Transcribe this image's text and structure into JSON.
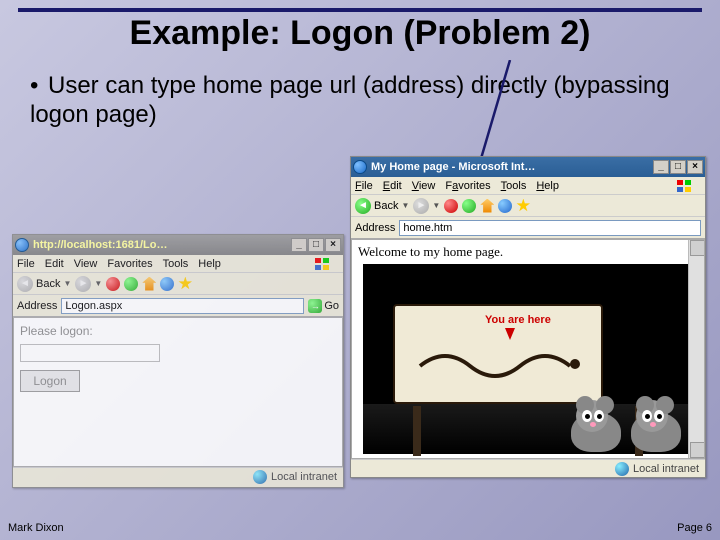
{
  "slide": {
    "title": "Example: Logon (Problem 2)",
    "bullet": "User can type home page url (address) directly (bypassing logon page)",
    "footer_left": "Mark Dixon",
    "footer_right": "Page 6"
  },
  "left_window": {
    "title": "http://localhost:1681/Lo…",
    "menu": {
      "file": "File",
      "edit": "Edit",
      "view": "View",
      "favorites": "Favorites",
      "tools": "Tools",
      "help": "Help"
    },
    "toolbar": {
      "back": "Back"
    },
    "address_label": "Address",
    "address_value": "Logon.aspx",
    "go_label": "Go",
    "content": {
      "prompt": "Please logon:",
      "button": "Logon"
    },
    "status": "Local intranet"
  },
  "right_window": {
    "title": "My Home page - Microsoft Int…",
    "menu": {
      "file": "File",
      "edit": "Edit",
      "view": "View",
      "favorites": "Favorites",
      "tools": "Tools",
      "help": "Help"
    },
    "toolbar": {
      "back": "Back"
    },
    "address_label": "Address",
    "address_value": "home.htm",
    "content": {
      "welcome": "Welcome to my home page.",
      "sign_text": "You are here"
    },
    "status": "Local intranet"
  },
  "window_controls": {
    "min": "_",
    "max": "□",
    "close": "×"
  }
}
